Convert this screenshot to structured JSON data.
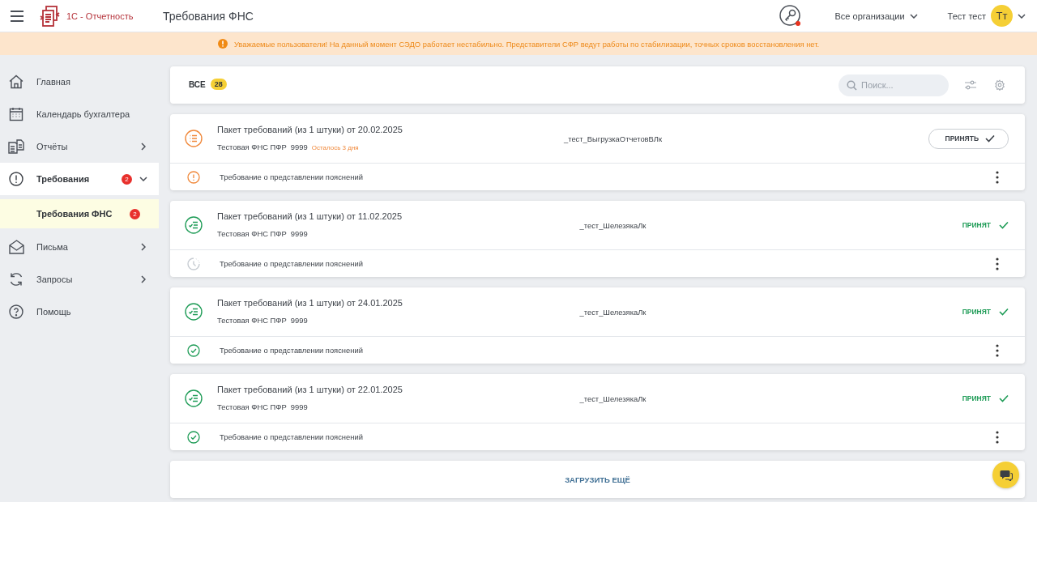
{
  "header": {
    "logo_text": "1С - Отчетность",
    "page_title": "Требования ФНС",
    "organizations": "Все организации",
    "user_name": "Тест тест",
    "user_initials": "Тт"
  },
  "banner": {
    "text": "Уважаемые пользователи! На данный момент СЭДО работает нестабильно. Представители СФР ведут работы по стабилизации, точных сроков восстановления нет."
  },
  "sidebar": {
    "items": [
      {
        "label": "Главная",
        "selected": false
      },
      {
        "label": "Календарь бухгалтера",
        "selected": false
      },
      {
        "label": "Отчёты",
        "selected": false,
        "expanded": false
      },
      {
        "label": "Требования",
        "selected": false,
        "badge": "2",
        "expanded": true,
        "children": [
          {
            "label": "Требования ФНС",
            "selected": true,
            "badge": "2"
          }
        ]
      },
      {
        "label": "Письма",
        "selected": false,
        "expanded": false
      },
      {
        "label": "Запросы",
        "selected": false,
        "expanded": false
      },
      {
        "label": "Помощь",
        "selected": false
      }
    ]
  },
  "filter_bar": {
    "tabs": [
      {
        "label": "ВСЕ",
        "count": "28",
        "selected": true
      }
    ],
    "search": {
      "placeholder": "Поиск..."
    }
  },
  "packages": [
    {
      "title": "Пакет требований (из 1 штуки) от 20.02.2025",
      "organization": "Тестовая ФНС ПФР  9999",
      "deadline": "Осталось 3 дня",
      "author": "_тест_ВыгрузкаОтчетовВЛк",
      "kind": "pending",
      "action": "ПРИНЯТЬ",
      "items": [
        {
          "text": "Требование о представлении пояснений",
          "kind": "warning"
        }
      ]
    },
    {
      "title": "Пакет требований (из 1 штуки) от 11.02.2025",
      "organization": "Тестовая ФНС ПФР  9999",
      "author": "_тест_ШелезякаЛк",
      "kind": "accepted",
      "status": "ПРИНЯТ",
      "items": [
        {
          "text": "Требование о представлении пояснений",
          "kind": "waiting"
        }
      ]
    },
    {
      "title": "Пакет требований (из 1 штуки) от 24.01.2025",
      "organization": "Тестовая ФНС ПФР  9999",
      "author": "_тест_ШелезякаЛк",
      "kind": "accepted",
      "status": "ПРИНЯТ",
      "items": [
        {
          "text": "Требование о представлении пояснений",
          "kind": "done"
        }
      ]
    },
    {
      "title": "Пакет требований (из 1 штуки) от 22.01.2025",
      "organization": "Тестовая ФНС ПФР  9999",
      "author": "_тест_ШелезякаЛк",
      "kind": "accepted",
      "status": "ПРИНЯТ",
      "items": [
        {
          "text": "Требование о представлении пояснений",
          "kind": "done"
        }
      ]
    }
  ],
  "load_more": "ЗАГРУЗИТЬ ЕЩЁ"
}
